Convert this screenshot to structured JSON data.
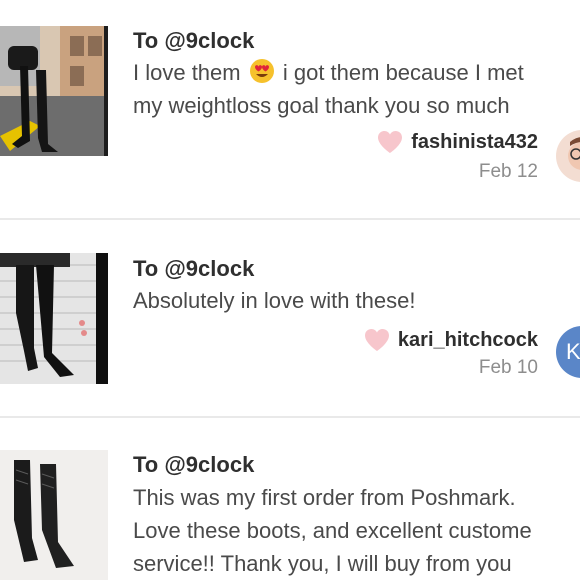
{
  "comments": [
    {
      "recipient": "To @9clock",
      "message_line1_before": "I love them",
      "emoji": "heart-eyes-emoji",
      "message_line1_after": "i got them because I met",
      "message_line2": "my weightloss goal thank you so much",
      "author": "fashinista432",
      "date": "Feb 12",
      "image_icon": "boots-photo-street",
      "avatar_icon": "user-photo-avatar"
    },
    {
      "recipient": "To @9clock",
      "message_line1": "Absolutely in love with these!",
      "author": "kari_hitchcock",
      "date": "Feb 10",
      "image_icon": "boots-photo-wall",
      "avatar_letter": "K"
    },
    {
      "recipient": "To @9clock",
      "message_line1": "This was my first order from Poshmark.",
      "message_line2": "Love these boots, and excellent custome",
      "message_line3": "service!! Thank you, I will buy from you",
      "image_icon": "boots-photo-studio"
    }
  ],
  "colors": {
    "heart": "#f7c6cc",
    "avatar_bg": "#5a86c8",
    "divider": "#e9e9e9"
  }
}
